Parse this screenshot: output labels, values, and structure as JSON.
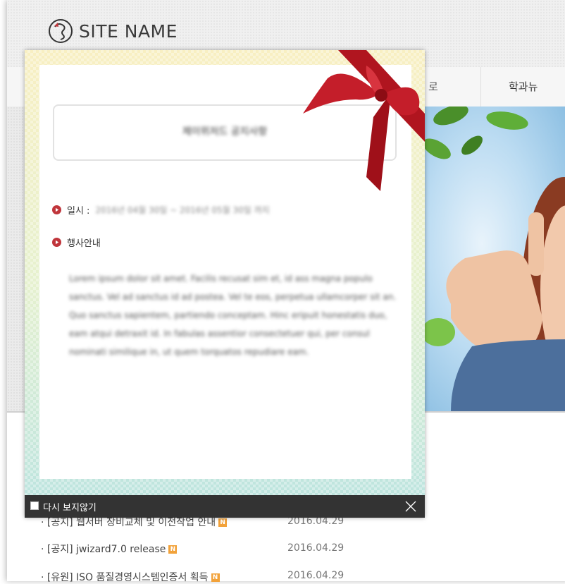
{
  "site": {
    "name": "SITE NAME"
  },
  "nav": {
    "partial_label": "로",
    "item_label": "학과뉴"
  },
  "popup": {
    "title": "제이위저드 공지사항",
    "date_label": "일시 :",
    "date_value": "2016년 04월 30일 ~ 2016년 05월 30일 까지",
    "event_label": "행사안내",
    "body_text": "Lorem ipsum dolor sit amet. Facilis recusat sim et, id ass magna populo sanctus. Vel ad sanctus id ad postea. Vel te eos, perpetua ullamcorper sit an. Quo sanctus sapientem, partiendo conceptam. Hinc eripuit honestatis duo, eam atqui detraxit id. In fabulas assentior consectetuer qui, per consul nominati similique in, ut quem torquatos repudiare eam.",
    "no_show_label": "다시 보지않기"
  },
  "news": [
    {
      "title": "· [공지] 웹서버 장비교체 및 이전작업 안내",
      "badge": "N",
      "date": "2016.04.29"
    },
    {
      "title": "· [공지] jwizard7.0 release",
      "badge": "N",
      "date": "2016.04.29"
    },
    {
      "title": "· [유원] ISO 품질경영시스템인증서 획득",
      "badge": "N",
      "date": "2016.04.29"
    }
  ],
  "colors": {
    "accent": "#c0353b",
    "footer": "#333333"
  }
}
